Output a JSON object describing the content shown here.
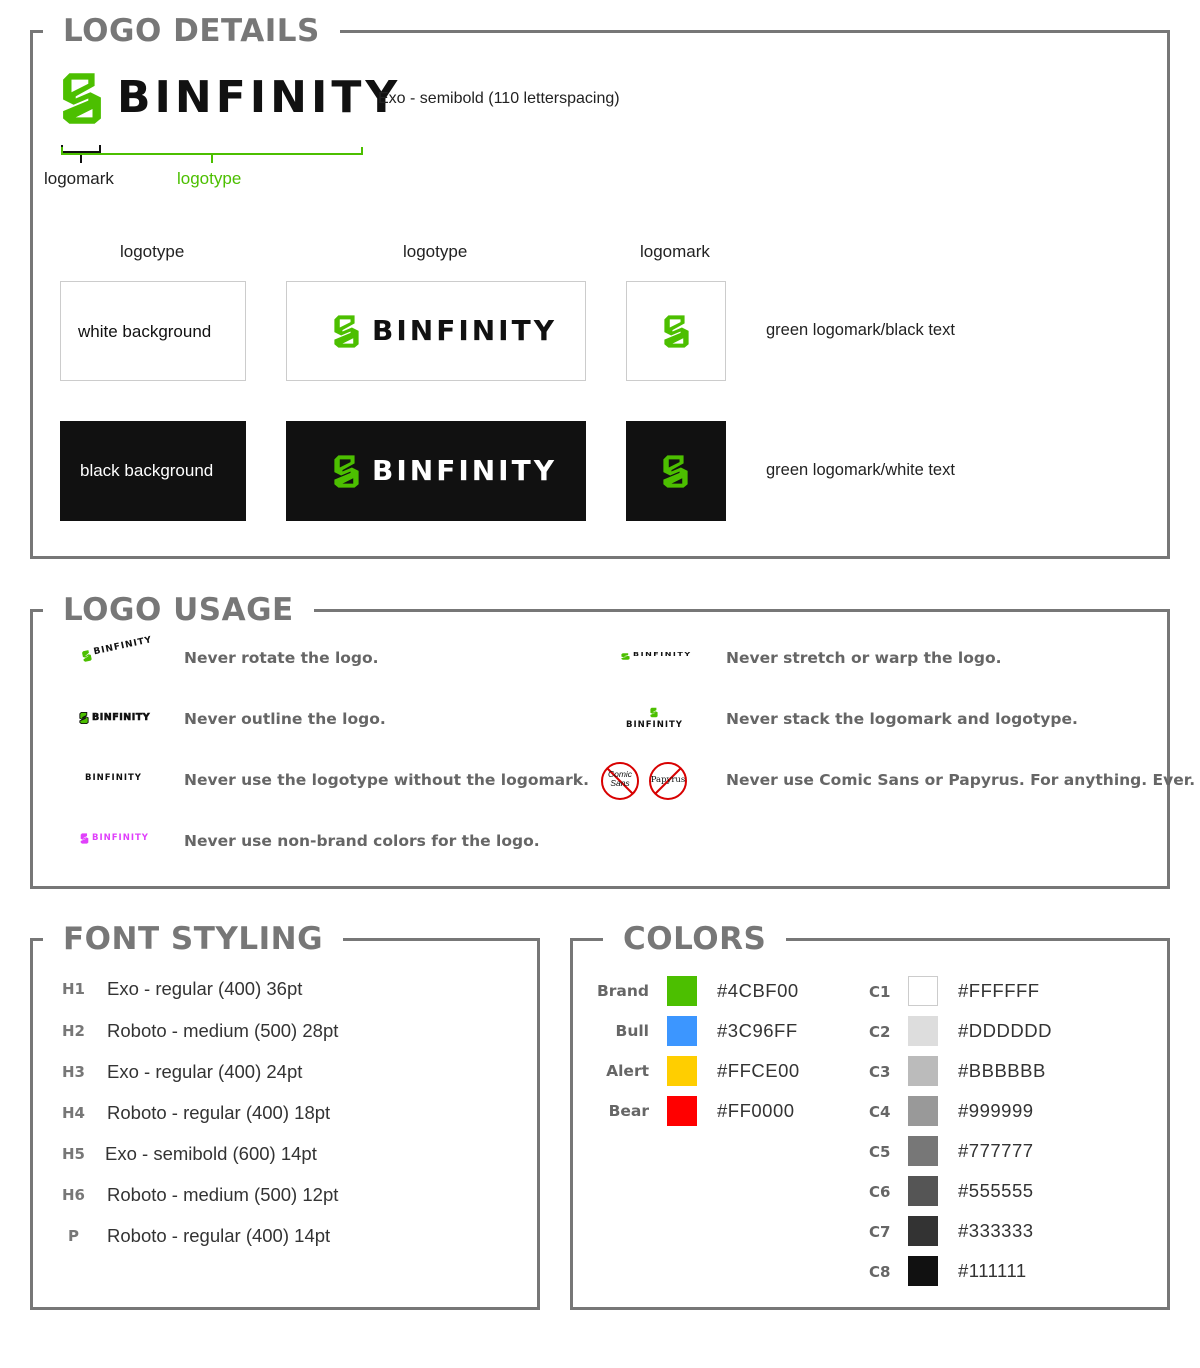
{
  "logo_details": {
    "heading": "LOGO DETAILS",
    "wordmark": "BINFINITY",
    "font_note": "Exo - semibold (110 letterspacing)",
    "logomark_label": "logomark",
    "logotype_label": "logotype",
    "columns": [
      "logotype",
      "logotype",
      "logomark"
    ],
    "rows": [
      {
        "label": "white background",
        "note": "green logomark/black text"
      },
      {
        "label": "black background",
        "note": "green logomark/white text"
      }
    ]
  },
  "logo_usage": {
    "heading": "LOGO USAGE",
    "rules": [
      "Never rotate the logo.",
      "Never outline the logo.",
      "Never use the logotype without the logomark.",
      "Never use non-brand colors for the logo.",
      "Never stretch or warp the logo.",
      "Never stack the logomark and logotype.",
      "Never use Comic Sans or Papyrus. For anything. Ever."
    ],
    "forbidden_fonts": [
      "Comic Sans",
      "Papyrus"
    ]
  },
  "font_styling": {
    "heading": "FONT STYLING",
    "items": [
      {
        "code": "H1",
        "desc": "Exo - regular (400) 36pt"
      },
      {
        "code": "H2",
        "desc": "Roboto - medium (500) 28pt"
      },
      {
        "code": "H3",
        "desc": "Exo - regular (400) 24pt"
      },
      {
        "code": "H4",
        "desc": "Roboto - regular (400) 18pt"
      },
      {
        "code": "H5",
        "desc": "Exo - semibold (600) 14pt"
      },
      {
        "code": "H6",
        "desc": "Roboto - medium (500) 12pt"
      },
      {
        "code": "P",
        "desc": "Roboto - regular (400) 14pt"
      }
    ]
  },
  "colors": {
    "heading": "COLORS",
    "brand": [
      {
        "name": "Brand",
        "hex": "#4CBF00"
      },
      {
        "name": "Bull",
        "hex": "#3C96FF"
      },
      {
        "name": "Alert",
        "hex": "#FFCE00"
      },
      {
        "name": "Bear",
        "hex": "#FF0000"
      }
    ],
    "grays": [
      {
        "name": "C1",
        "hex": "#FFFFFF"
      },
      {
        "name": "C2",
        "hex": "#DDDDDD"
      },
      {
        "name": "C3",
        "hex": "#BBBBBB"
      },
      {
        "name": "C4",
        "hex": "#999999"
      },
      {
        "name": "C5",
        "hex": "#777777"
      },
      {
        "name": "C6",
        "hex": "#555555"
      },
      {
        "name": "C7",
        "hex": "#333333"
      },
      {
        "name": "C8",
        "hex": "#111111"
      }
    ]
  },
  "theme": {
    "brand_green": "#4CBF00",
    "panel_border": "#777777",
    "black": "#111111",
    "nonbrand_pink": "#E040FB"
  }
}
